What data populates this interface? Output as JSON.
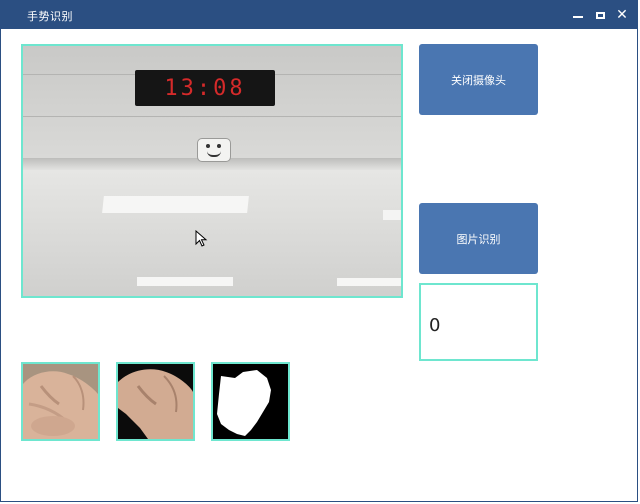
{
  "window": {
    "title": "手势识别",
    "controls": [
      "minimize-icon",
      "maximize-icon",
      "close-icon"
    ]
  },
  "camera": {
    "clock_text": "13:08"
  },
  "buttons": {
    "close_camera": "关闭摄像头",
    "recognize_image": "图片识别"
  },
  "result": {
    "value": "0"
  },
  "thumbnails": [
    "hand-original",
    "hand-cropped",
    "hand-binary-mask"
  ],
  "colors": {
    "titlebar": "#2b4f82",
    "button": "#4a76b1",
    "frame_border": "#6ee6cf"
  }
}
